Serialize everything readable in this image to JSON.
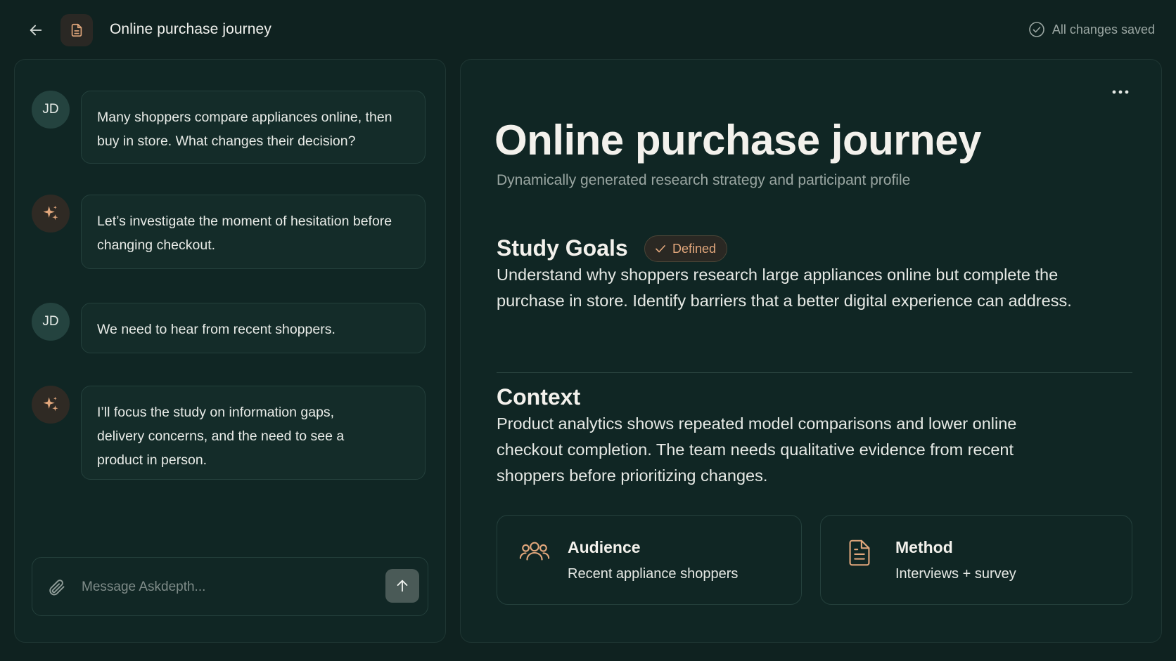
{
  "header": {
    "title": "Online purchase journey",
    "save_status": "All changes saved"
  },
  "chat": {
    "messages": [
      {
        "role": "user",
        "avatar": "JD",
        "text": "Many shoppers compare appliances online, then buy in store. What changes their decision?"
      },
      {
        "role": "assistant",
        "avatar_icon": "sparkle-icon",
        "text": "Let’s investigate the moment of hesitation before changing checkout."
      },
      {
        "role": "user",
        "avatar": "JD",
        "text": "We need to hear from recent shoppers."
      },
      {
        "role": "assistant",
        "avatar_icon": "sparkle-icon",
        "text": "I’ll focus the study on information gaps, delivery concerns, and the need to see a product in person."
      }
    ],
    "composer": {
      "placeholder": "Message Askdepth...",
      "value": ""
    }
  },
  "document": {
    "title": "Online purchase journey",
    "subtitle": "Dynamically generated research strategy and participant profile",
    "study_goals": {
      "heading": "Study Goals",
      "badge": "Defined",
      "text": "Understand why shoppers research large appliances online but complete the purchase in store. Identify barriers that a better digital experience can address."
    },
    "context": {
      "heading": "Context",
      "text": "Product analytics shows repeated model comparisons and lower online checkout completion. The team needs qualitative evidence from recent shoppers before prioritizing changes."
    },
    "cards": [
      {
        "icon": "users-icon",
        "title": "Audience",
        "value": "Recent appliance shoppers"
      },
      {
        "icon": "document-icon",
        "title": "Method",
        "value": "Interviews + survey"
      }
    ]
  },
  "colors": {
    "background": "#0f2220",
    "panel": "#102624",
    "accent": "#e2a77c",
    "muted_text": "#9aa6a2"
  }
}
